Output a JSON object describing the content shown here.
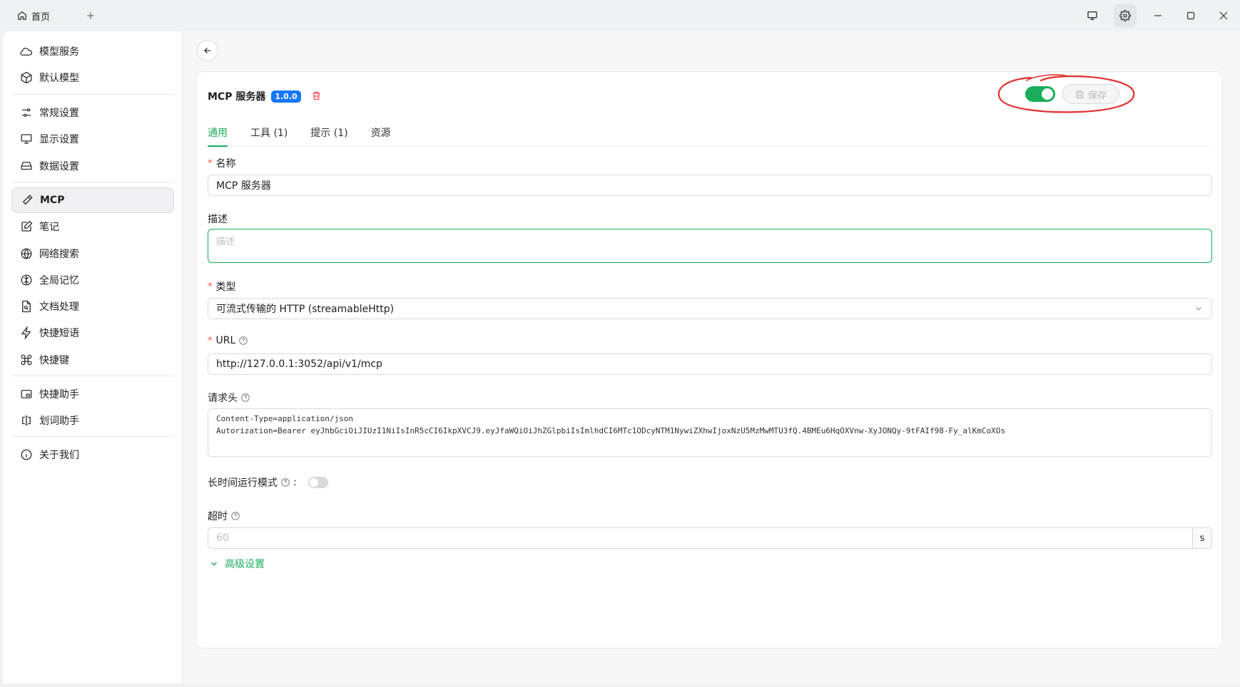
{
  "titlebar": {
    "home_tab_label": "首页"
  },
  "sidebar": {
    "items": [
      {
        "label": "模型服务",
        "icon": "cloud-icon"
      },
      {
        "label": "默认模型",
        "icon": "cube-icon"
      },
      {
        "label": "常规设置",
        "icon": "sliders-icon"
      },
      {
        "label": "显示设置",
        "icon": "monitor-icon"
      },
      {
        "label": "数据设置",
        "icon": "hard-drive-icon"
      },
      {
        "label": "MCP",
        "icon": "hammer-icon",
        "active": true
      },
      {
        "label": "笔记",
        "icon": "note-edit-icon"
      },
      {
        "label": "网络搜索",
        "icon": "globe-icon"
      },
      {
        "label": "全局记忆",
        "icon": "brain-icon"
      },
      {
        "label": "文档处理",
        "icon": "file-search-icon"
      },
      {
        "label": "快捷短语",
        "icon": "zap-icon"
      },
      {
        "label": "快捷键",
        "icon": "command-icon"
      },
      {
        "label": "快捷助手",
        "icon": "app-window-icon"
      },
      {
        "label": "划词助手",
        "icon": "text-cursor-icon"
      },
      {
        "label": "关于我们",
        "icon": "info-icon"
      }
    ]
  },
  "server": {
    "name": "MCP 服务器",
    "version": "1.0.0",
    "enabled": true,
    "save_label": "保存"
  },
  "tabs": [
    {
      "label": "通用",
      "active": true
    },
    {
      "label": "工具 (1)"
    },
    {
      "label": "提示 (1)"
    },
    {
      "label": "资源"
    }
  ],
  "form": {
    "name": {
      "label": "名称",
      "value": "MCP 服务器",
      "required": true
    },
    "description": {
      "label": "描述",
      "placeholder": "描述"
    },
    "type": {
      "label": "类型",
      "value": "可流式传输的 HTTP (streamableHttp)",
      "required": true
    },
    "url": {
      "label": "URL",
      "value": "http://127.0.0.1:3052/api/v1/mcp",
      "required": true
    },
    "headers": {
      "label": "请求头",
      "lines": [
        "Content-Type=application/json",
        "Autorization=Bearer eyJhbGciOiJIUzI1NiIsInR5cCI6IkpXVCJ9.eyJfaWQiOiJhZGlpbiIsImlhdCI6MTc1ODcyNTM1NywiZXhwIjoxNzU5MzMwMTU3fQ.4BMEu6HqOXVnw-XyJONQy-9tFAIf98-Fy_alKmCoXOs"
      ]
    },
    "long_running": {
      "label": "长时间运行模式",
      "suffix": ":",
      "enabled": false
    },
    "timeout": {
      "label": "超时",
      "placeholder": "60",
      "unit": "s"
    },
    "advanced_label": "高级设置"
  },
  "colors": {
    "accent": "#1aad5b",
    "badge": "#1677ff",
    "danger": "#ff4d4f",
    "annotation": "#e23030"
  }
}
